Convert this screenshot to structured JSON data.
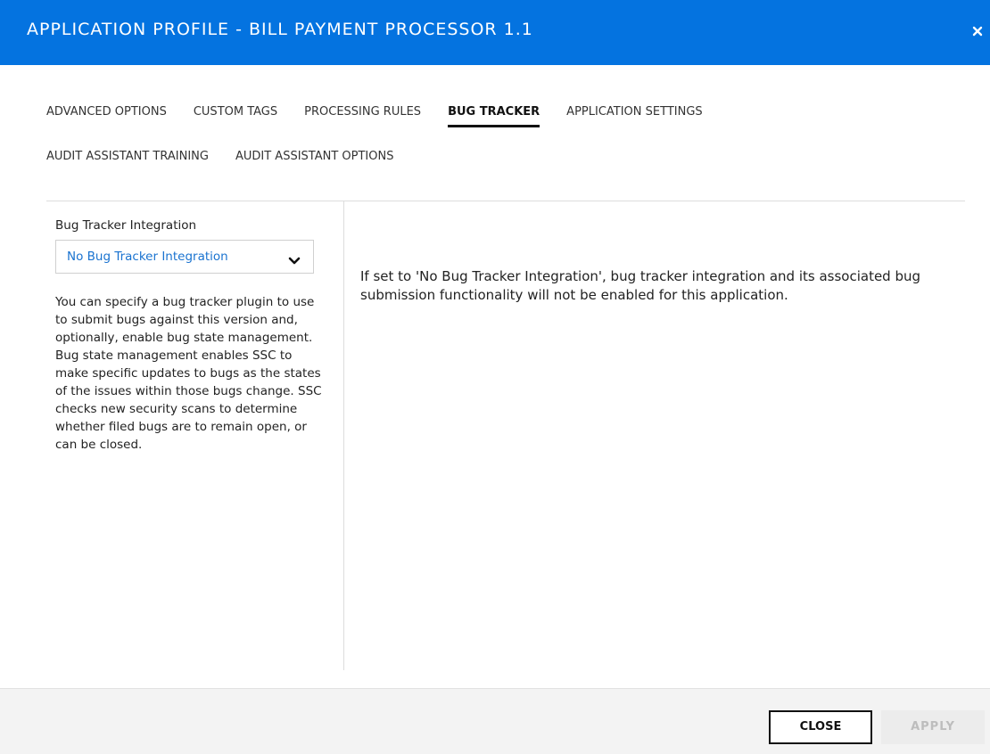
{
  "dialog": {
    "title": "APPLICATION PROFILE - BILL PAYMENT PROCESSOR 1.1",
    "close_icon": "close-icon",
    "accent_color": "#0473e0"
  },
  "tabs": {
    "row1": [
      {
        "label": "ADVANCED OPTIONS",
        "active": false
      },
      {
        "label": "CUSTOM TAGS",
        "active": false
      },
      {
        "label": "PROCESSING RULES",
        "active": false
      },
      {
        "label": "BUG TRACKER",
        "active": true
      },
      {
        "label": "APPLICATION SETTINGS",
        "active": false
      }
    ],
    "row2": [
      {
        "label": "AUDIT ASSISTANT TRAINING",
        "active": false
      },
      {
        "label": "AUDIT ASSISTANT OPTIONS",
        "active": false
      }
    ]
  },
  "bug_tracker": {
    "field_label": "Bug Tracker Integration",
    "selected_value": "No Bug Tracker Integration",
    "chevron_icon": "chevron-down-icon",
    "help_text": "You can specify a bug tracker plugin to use to submit bugs against this version and, optionally, enable bug state management. Bug state management enables SSC to make specific updates to bugs as the states of the issues within those bugs change. SSC checks new security scans to determine whether filed bugs are to remain open, or can be closed.",
    "description": "If set to 'No Bug Tracker Integration', bug tracker integration and its associated bug submission functionality will not be enabled for this application."
  },
  "footer": {
    "close_label": "CLOSE",
    "apply_label": "APPLY"
  }
}
